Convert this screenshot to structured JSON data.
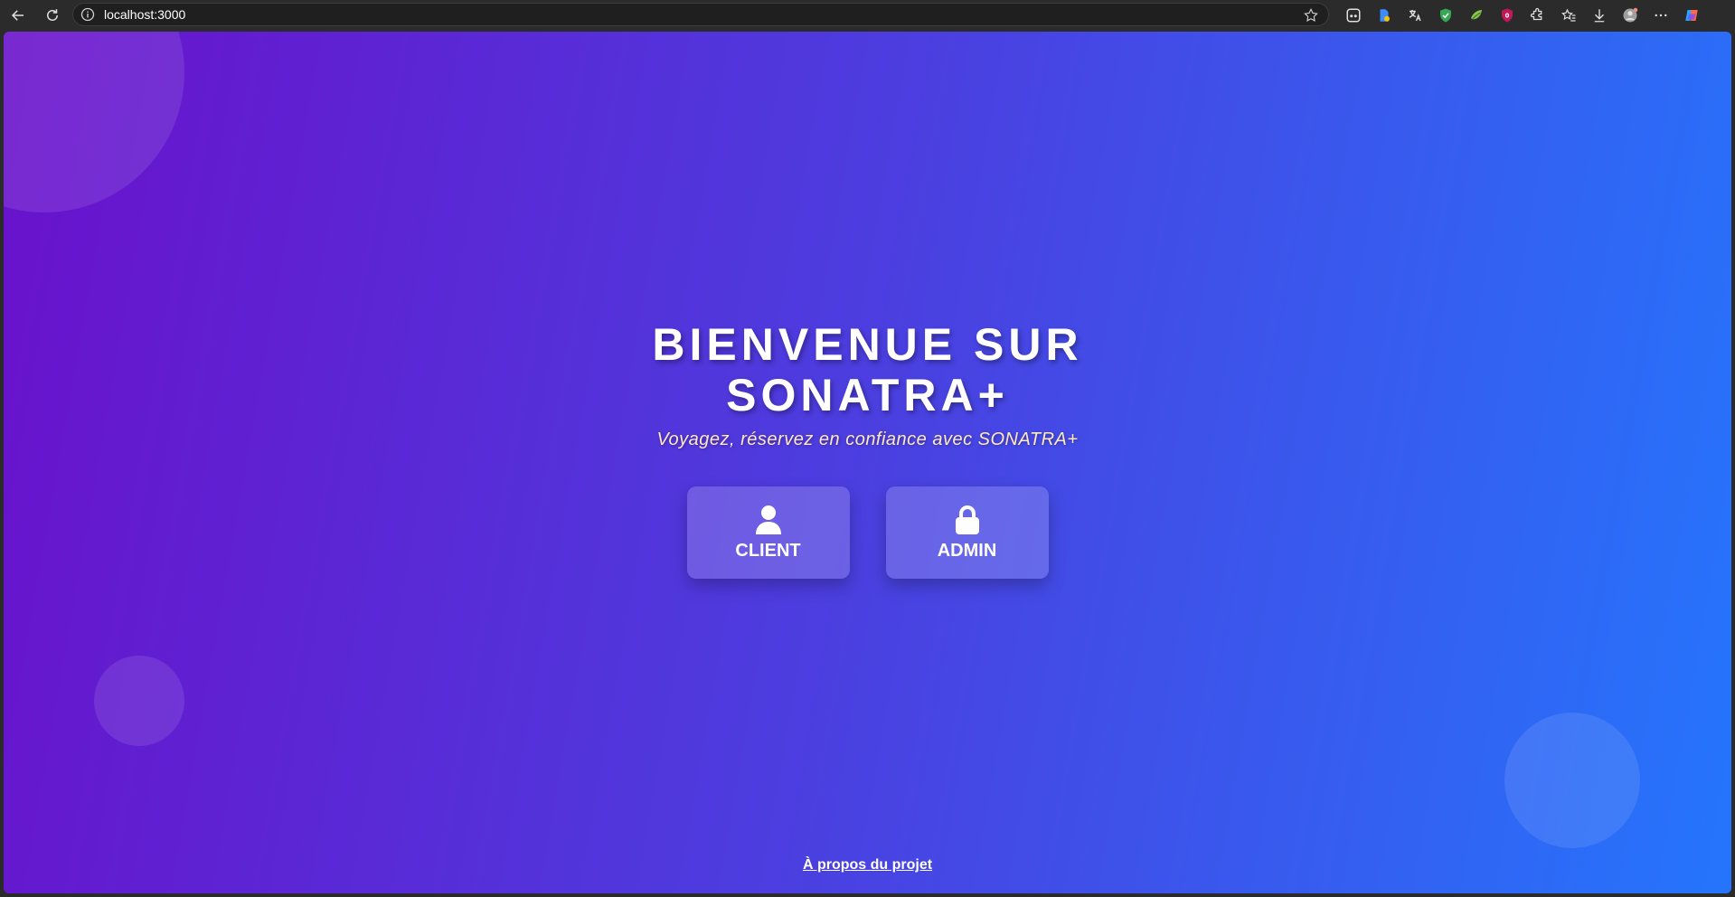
{
  "browser": {
    "url": "localhost:3000",
    "back_icon": "back-arrow-icon",
    "reload_icon": "reload-icon",
    "info_icon": "info-icon",
    "star_icon": "star-icon"
  },
  "page": {
    "title": "BIENVENUE SUR SONATRA+",
    "subtitle": "Voyagez, réservez en confiance avec SONATRA+",
    "buttons": [
      {
        "label": "CLIENT",
        "icon": "user-icon"
      },
      {
        "label": "ADMIN",
        "icon": "lock-icon"
      }
    ],
    "footer_link": "À propos du projet"
  },
  "colors": {
    "gradient_start": "#6a11cb",
    "gradient_end": "#2575fc",
    "subtitle": "#ffe8c2"
  }
}
